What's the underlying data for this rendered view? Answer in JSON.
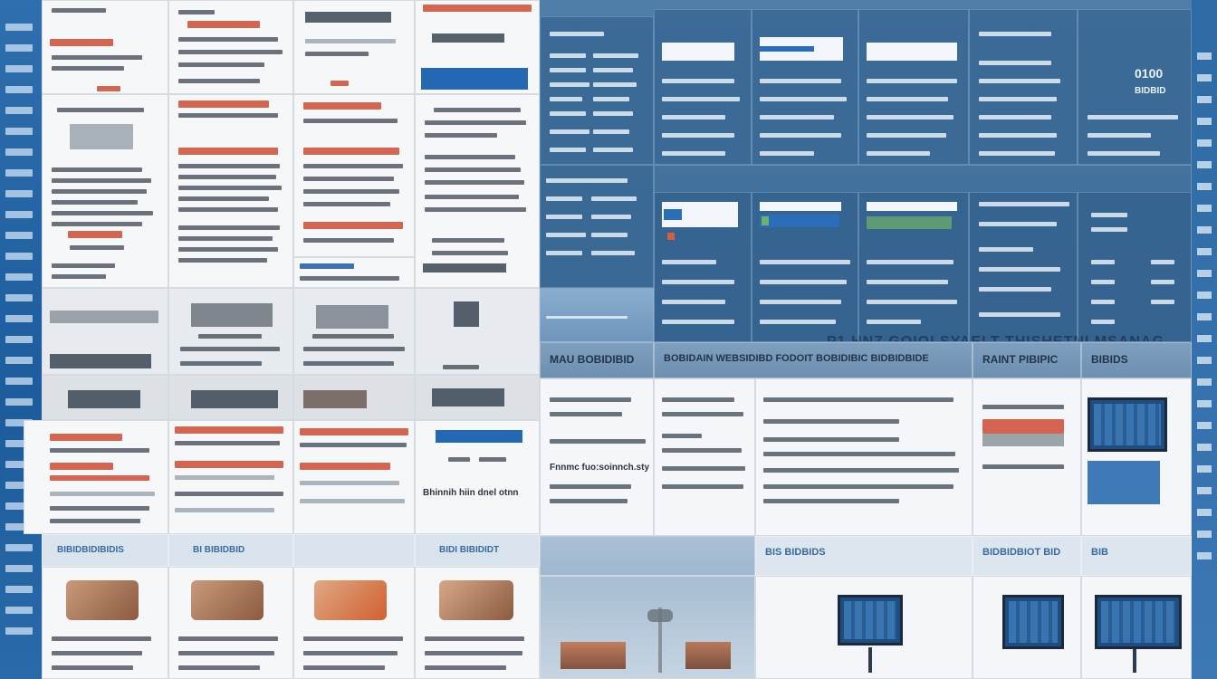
{
  "banner": {
    "title": "P1 HNZ GOIOI SYAELT THISHETNI MSANAG"
  },
  "section_headers": [
    {
      "label": "MAU BOBIDIBID"
    },
    {
      "label": "BOBIDAIN WEBSIDIBD FODOIT BOBIDIBIC BIDBIDBIDE"
    },
    {
      "label": "RAINT PIBIPIC"
    },
    {
      "label": "BIBIDS"
    }
  ],
  "doc_headers": [
    {
      "label": "BIBIDBIDIBIDIS"
    },
    {
      "label": "BI BIBIDBID"
    },
    {
      "label": "BIDI BIBIDIDT"
    }
  ],
  "lower_headers": [
    {
      "label": "BIS BIDBIDS"
    },
    {
      "label": "BIDBIDBIOT BID"
    },
    {
      "label": "BIB"
    }
  ],
  "content_snippets": [
    {
      "label": "Fnnmc fuo:soinnch.sty"
    },
    {
      "label": "Bhinnih hiin dnel otnn"
    }
  ],
  "dash_labels": [
    {
      "label": "0100"
    },
    {
      "label": "BIDBID"
    }
  ],
  "colors": {
    "accent_blue": "#2468b4",
    "accent_red": "#d0543e",
    "dash_bg": "#4f7ea9"
  }
}
